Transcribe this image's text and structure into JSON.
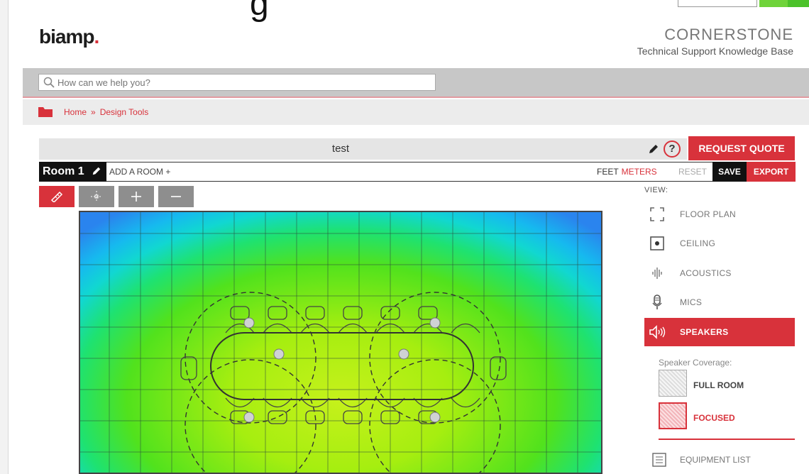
{
  "chrome": {
    "fragment": "g"
  },
  "header": {
    "logo_text": "biamp",
    "logo_dot": ".",
    "brand_title": "CORNERSTONE",
    "brand_subtitle": "Technical Support Knowledge Base"
  },
  "search": {
    "placeholder": "How can we help you?",
    "icon": "search-icon"
  },
  "breadcrumb": {
    "home": "Home",
    "separator": "»",
    "current": "Design Tools"
  },
  "tool": {
    "title": "test",
    "request_quote": "REQUEST QUOTE",
    "help": "?"
  },
  "rooms": {
    "active_room": "Room 1",
    "add_room": "ADD A ROOM +",
    "unit_feet": "FEET",
    "unit_meters": "METERS",
    "reset": "RESET",
    "save": "SAVE",
    "export": "EXPORT"
  },
  "toolbar": {
    "tools": [
      {
        "icon": "ruler-icon",
        "active": true
      },
      {
        "icon": "move-icon",
        "active": false
      },
      {
        "icon": "zoom-in-icon",
        "active": false
      },
      {
        "icon": "zoom-out-icon",
        "active": false
      }
    ]
  },
  "view": {
    "label": "VIEW:",
    "items": [
      {
        "label": "FLOOR PLAN",
        "icon": "floor-plan-icon",
        "active": false
      },
      {
        "label": "CEILING",
        "icon": "ceiling-icon",
        "active": false
      },
      {
        "label": "ACOUSTICS",
        "icon": "acoustics-icon",
        "active": false
      },
      {
        "label": "MICS",
        "icon": "microphone-icon",
        "active": false
      },
      {
        "label": "SPEAKERS",
        "icon": "speaker-icon",
        "active": true
      }
    ]
  },
  "coverage": {
    "label": "Speaker Coverage:",
    "full_room": "FULL ROOM",
    "focused": "FOCUSED",
    "selected": "FOCUSED"
  },
  "equipment": {
    "label": "EQUIPMENT LIST",
    "icon": "list-icon"
  },
  "colors": {
    "accent": "#d8323b",
    "dark": "#111111",
    "tool_gray": "#8e8e8e"
  }
}
